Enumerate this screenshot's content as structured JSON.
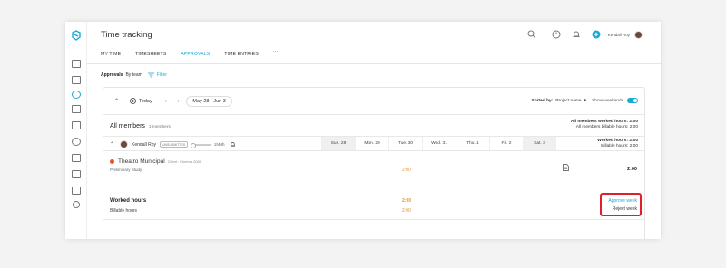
{
  "app": {
    "title": "Time tracking"
  },
  "header": {
    "user_name": "Kendall Roy"
  },
  "tabs": [
    {
      "label": "MY TIME"
    },
    {
      "label": "TIMESHEETS"
    },
    {
      "label": "APPROVALS"
    },
    {
      "label": "TIME ENTRIES"
    },
    {
      "label": "···"
    }
  ],
  "filters": {
    "approvals_label": "Approvals",
    "by_team": "By team",
    "filter_label": "Filter"
  },
  "toolbar": {
    "today_label": "Today",
    "date_range": "May 28 - Jun 3",
    "sorted_by_label": "Sorted by:",
    "sorted_by_value": "Project name",
    "show_weekends_label": "Show weekends"
  },
  "all_members": {
    "title": "All members",
    "count": "1 members",
    "worked": "All members worked hours: 2:00",
    "billable": "All members billable hours: 2:00"
  },
  "member": {
    "name": "Kendall Roy",
    "badge": "UNSUBMITTED",
    "progress_text": "2/40h",
    "progress_fraction": 0.05,
    "worked": "Worked hours: 2:00",
    "billable": "Billable hours: 2:00"
  },
  "days": [
    "Sun. 28",
    "Mon. 29",
    "Tue. 30",
    "Wed. 31",
    "Thu. 1",
    "Fri. 2",
    "Sat. 3"
  ],
  "project": {
    "name": "Theatro Municipal",
    "client": "Client : Cinema 2000",
    "subtask": "Preliminary Study",
    "day_value": "2:00",
    "total": "2:00",
    "color": "#e8532b"
  },
  "summary": {
    "worked_label": "Worked hours",
    "billable_label": "Billable hours",
    "worked_value": "2:00",
    "billable_value": "2:00",
    "approve_label": "Approve week",
    "reject_label": "Reject week"
  },
  "colors": {
    "accent": "#19a9d6",
    "highlight": "#e01f2a",
    "hours": "#e0922f"
  }
}
